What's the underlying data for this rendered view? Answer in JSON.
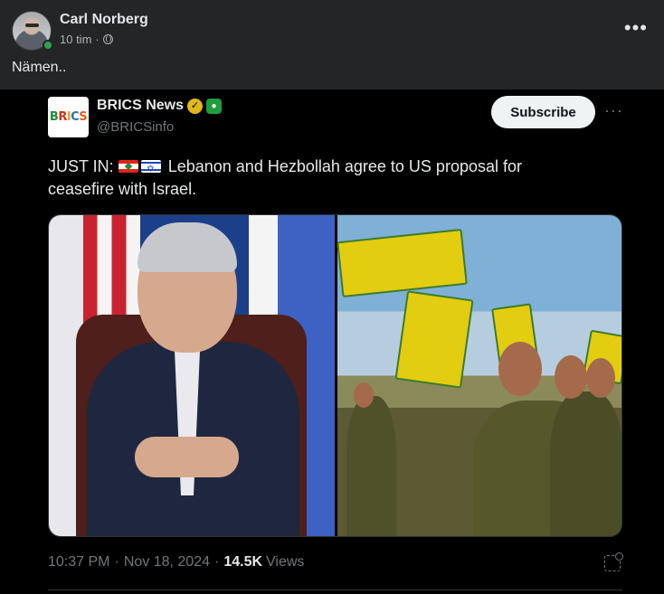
{
  "post": {
    "author": "Carl Norberg",
    "time": "10 tim",
    "separator": "·",
    "caption": "Nämen..",
    "more": "•••"
  },
  "tweet": {
    "logo_letters": [
      "B",
      "R",
      "I",
      "C",
      "S"
    ],
    "name": "BRICS News",
    "handle": "@BRICSinfo",
    "subscribe_label": "Subscribe",
    "more": "···",
    "text_prefix": "JUST IN:",
    "text_body": "Lebanon and Hezbollah agree to US proposal for ceasefire with Israel.",
    "flags": [
      "lebanon-flag",
      "israel-flag"
    ],
    "time": "10:37 PM",
    "date": "Nov 18, 2024",
    "views_count": "14.5K",
    "views_label": "Views"
  },
  "colors": {
    "fb_background": "#242526",
    "tweet_background": "#000000",
    "verified_gold": "#e2b719",
    "online_green": "#31a24c"
  }
}
